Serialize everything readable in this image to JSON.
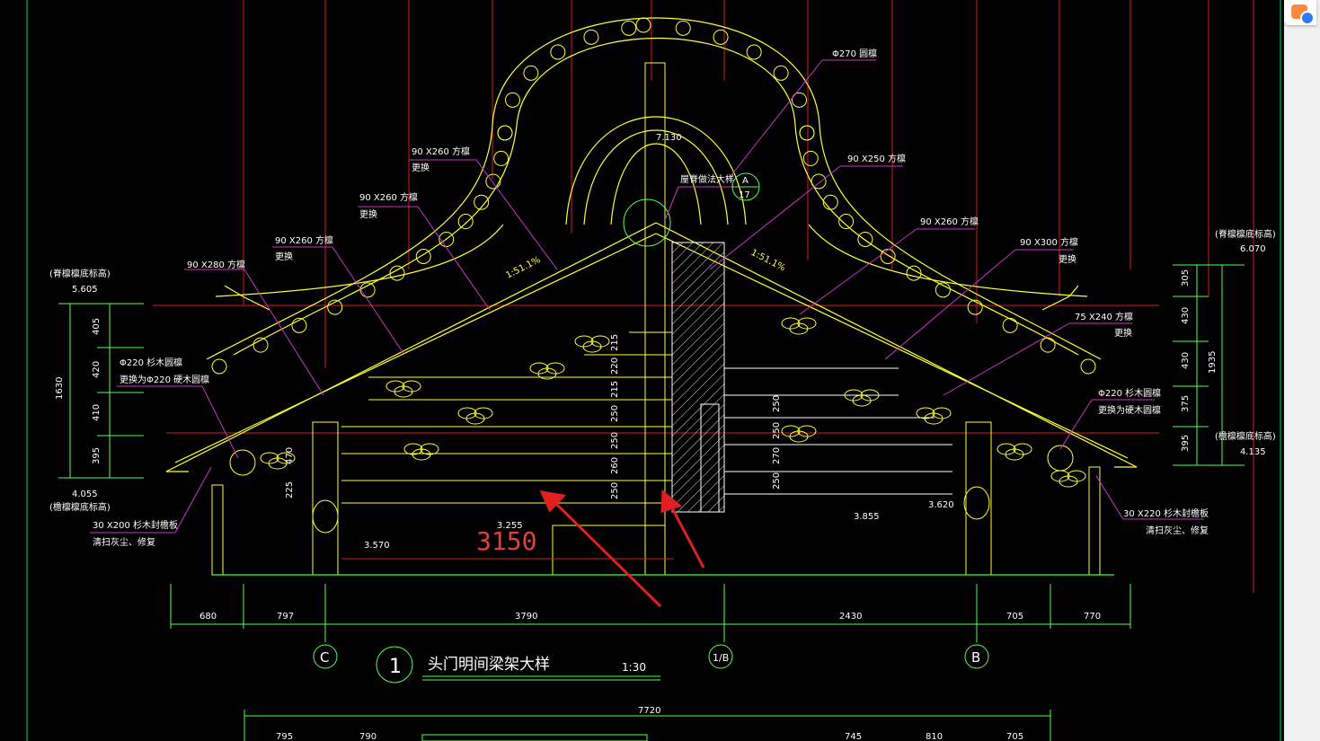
{
  "drawing": {
    "title_number": "1",
    "title": "头门明间梁架大样",
    "scale": "1:30",
    "axis_labels": [
      "C",
      "1/B",
      "B"
    ],
    "overall_dim": "7720",
    "overall_handwritten": "3150",
    "bottom_dims_top": [
      "680",
      "797",
      "3790",
      "2430",
      "705",
      "770"
    ],
    "bottom_dims_low": [
      "795",
      "790",
      "745",
      "810",
      "705"
    ],
    "left_elev_label": "(脊檩檩底标高)",
    "left_elev_value": "5.605",
    "left_eave_label": "(檐檩檩底标高)",
    "left_eave_value": "4.055",
    "right_elev_label": "(脊檩檩底标高)",
    "right_elev_value": "6.070",
    "right_eave_label": "(檐檩檩底标高)",
    "right_eave_value": "4.135",
    "left_vert_dims": [
      "405",
      "420",
      "410",
      "395"
    ],
    "left_vert_total": "1630",
    "right_vert_dims": [
      "305",
      "430",
      "430",
      "375",
      "395"
    ],
    "right_vert_total": "1935",
    "mid_dims": [
      "215",
      "220",
      "215",
      "250",
      "250",
      "260",
      "250"
    ],
    "right_mid_dims": [
      "250",
      "250",
      "270",
      "250"
    ],
    "small_dims": [
      "470",
      "225"
    ],
    "levels": [
      "3.255",
      "3.570",
      "3.855",
      "3.620",
      "7.130"
    ],
    "ridge_note": "屋脊做法大样",
    "ridge_ref_top": "A",
    "ridge_ref_bot": "17",
    "slopes": [
      "1:51.1%",
      "1:51.1%"
    ],
    "annotations_left": [
      {
        "l1": "90 X260  方檩",
        "l2": "更换"
      },
      {
        "l1": "90 X260  方檩",
        "l2": "更换"
      },
      {
        "l1": "90 X260  方檩",
        "l2": "更换"
      },
      {
        "l1": "90 X280  方檩",
        "l2": ""
      },
      {
        "l1": "Φ220  杉木圆檩",
        "l2": "更换为Φ220  硬木圆檩"
      },
      {
        "l1": "30 X200  杉木封檐板",
        "l2": "清扫灰尘、修复"
      }
    ],
    "annotations_right": [
      {
        "l1": "Φ270  圆檩",
        "l2": ""
      },
      {
        "l1": "90 X250  方檩",
        "l2": ""
      },
      {
        "l1": "90 X260  方檩",
        "l2": ""
      },
      {
        "l1": "90 X300  方檩",
        "l2": "更换"
      },
      {
        "l1": "75 X240  方檩",
        "l2": "更换"
      },
      {
        "l1": "Φ220  杉木圆檩",
        "l2": "更换为硬木圆檩"
      },
      {
        "l1": "30 X220  杉木封檐板",
        "l2": "清扫灰尘、修复"
      }
    ]
  }
}
